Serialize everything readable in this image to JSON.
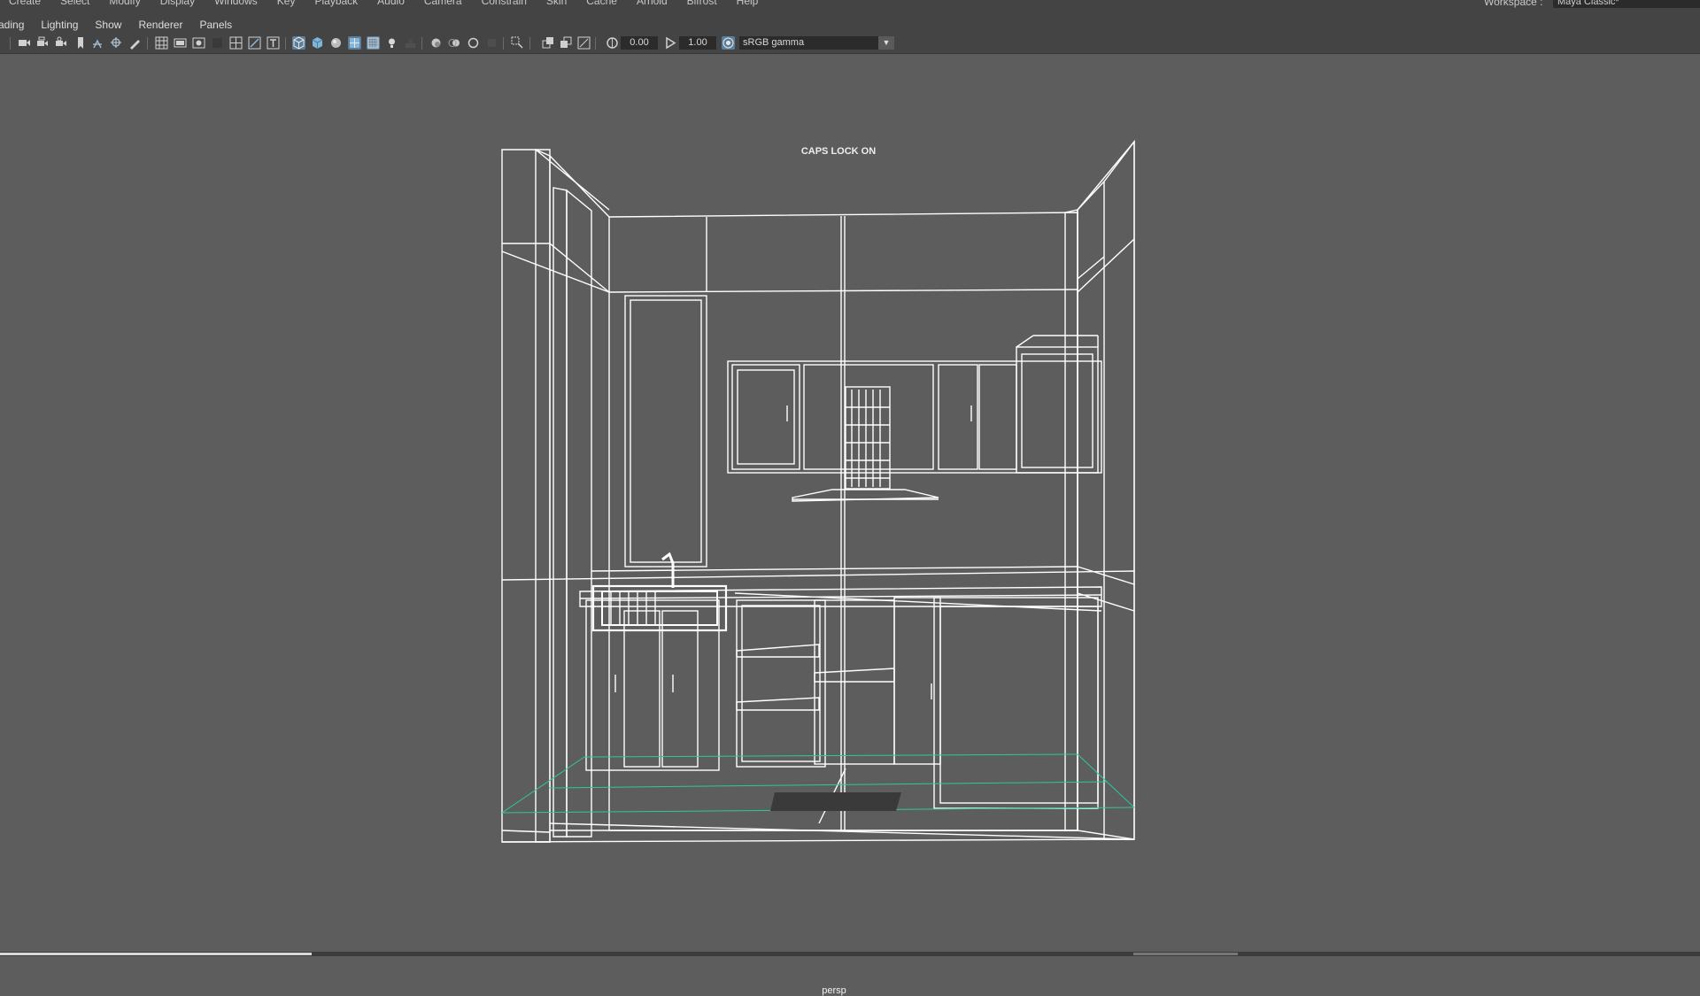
{
  "colors": {
    "panel": "#444444",
    "viewport_bg": "#5d5d5d",
    "wire": "#ffffff",
    "grid_accent": "#2ec8a0",
    "toggle_on": "#5b7f9b"
  },
  "top_menu": {
    "items": [
      "Create",
      "Select",
      "Modify",
      "Display",
      "Windows",
      "Key",
      "Playback",
      "Audio",
      "Camera",
      "Constrain",
      "Skin",
      "Cache",
      "Arnold",
      "Bifrost",
      "Help"
    ],
    "workspace_label": "Workspace :",
    "workspace_value": "Maya Classic*"
  },
  "panel_menu": {
    "items": [
      "ading",
      "Lighting",
      "Show",
      "Renderer",
      "Panels"
    ]
  },
  "toolbar": {
    "icons": [
      "camera-select-icon",
      "camera-attributes-icon",
      "bookmarks-icon",
      "image-plane-icon",
      "2d-pan-zoom-icon",
      "grease-pencil-icon",
      "grid-icon",
      "film-gate-icon",
      "resolution-gate-icon",
      "gate-mask-icon",
      "field-chart-icon",
      "safe-action-icon",
      "safe-title-icon",
      "wireframe-icon",
      "smooth-shade-icon",
      "default-material-icon",
      "wireframe-on-shaded-icon",
      "xray-icon",
      "use-all-lights-icon",
      "shadows-icon",
      "screen-space-ao-icon",
      "motion-blur-icon",
      "anti-aliasing-icon",
      "depth-of-field-icon",
      "isolate-select-icon",
      "xray-joints-icon",
      "xray-active-icon",
      "backface-icon",
      "exposure-icon",
      "gamma-icon",
      "color-management-icon"
    ],
    "exposure_value": "0.00",
    "gamma_value": "1.00",
    "view_transform": "sRGB gamma"
  },
  "viewport": {
    "hud_message": "CAPS LOCK ON",
    "camera_name": "persp"
  }
}
